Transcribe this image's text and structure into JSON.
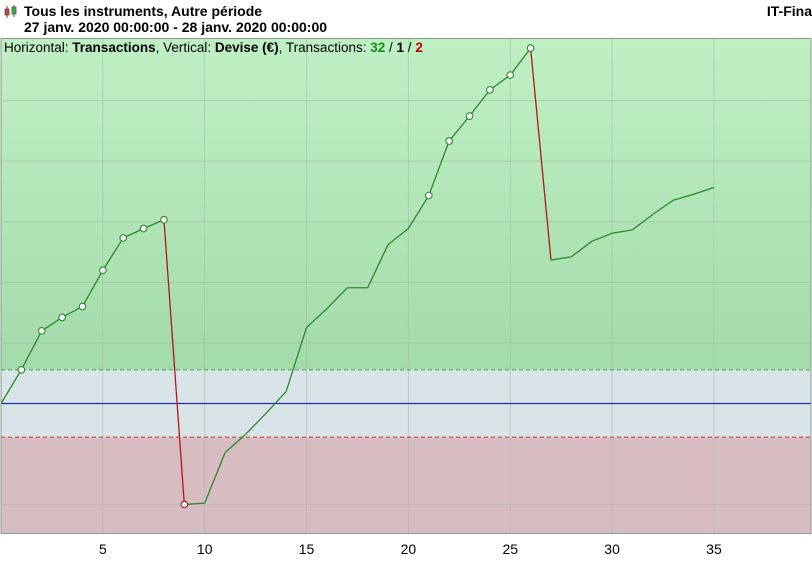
{
  "header": {
    "title": "Tous les instruments, Autre période",
    "period": "27 janv. 2020 00:00:00 - 28 janv. 2020 00:00:00",
    "brand": "IT-Fina"
  },
  "info": {
    "horizontal_label": "Horizontal:",
    "horizontal_value": "Transactions",
    "vertical_label": ", Vertical:",
    "vertical_value": "Devise (€)",
    "transactions_label": ", Transactions:",
    "win_count": "32",
    "sep1": " / ",
    "neutral_count": "1",
    "sep2": " / ",
    "loss_count": "2"
  },
  "colors": {
    "profit_zone_top": "#bff0c4",
    "profit_zone_bottom": "#a4dbab",
    "neutral_zone": "#d9e4e8",
    "loss_zone": "#d7bcc2",
    "equity_up": "#2a8a2a",
    "equity_down": "#b01818",
    "baseline": "#1f2fa0",
    "upper_dashed": "#4a9a5a",
    "lower_dashed": "#cc3333",
    "grid": "#9cbca0"
  },
  "chart_data": {
    "type": "line",
    "xlabel": "",
    "ylabel": "",
    "x_ticks": [
      5,
      10,
      15,
      20,
      25,
      30,
      35
    ],
    "xlim": [
      0,
      39.8
    ],
    "grid": true,
    "series": [
      {
        "x": [
          0,
          1,
          2,
          3,
          4,
          5,
          6,
          7,
          8,
          9,
          10,
          11,
          12,
          13,
          14,
          15,
          16,
          17,
          18,
          19,
          20,
          21,
          22,
          23,
          24,
          25,
          26,
          27,
          28,
          29,
          30,
          31,
          32,
          33,
          34,
          35
        ],
        "y": [
          0.0,
          0.5,
          1.08,
          1.28,
          1.44,
          1.98,
          2.46,
          2.6,
          2.73,
          -1.5,
          -1.48,
          -0.73,
          -0.46,
          -0.15,
          0.18,
          1.13,
          1.41,
          1.72,
          1.72,
          2.36,
          2.6,
          3.09,
          3.9,
          4.27,
          4.66,
          4.88,
          5.28,
          2.13,
          2.18,
          2.41,
          2.53,
          2.58,
          2.81,
          3.02,
          3.11,
          3.21
        ]
      }
    ],
    "markers": [
      1,
      2,
      3,
      4,
      5,
      6,
      7,
      8,
      9,
      21,
      22,
      23,
      24,
      25,
      26
    ],
    "loss_segments": [
      [
        8,
        9
      ],
      [
        26,
        27
      ]
    ],
    "upper_threshold": 0.5,
    "lower_threshold": -0.5,
    "baseline": 0
  }
}
